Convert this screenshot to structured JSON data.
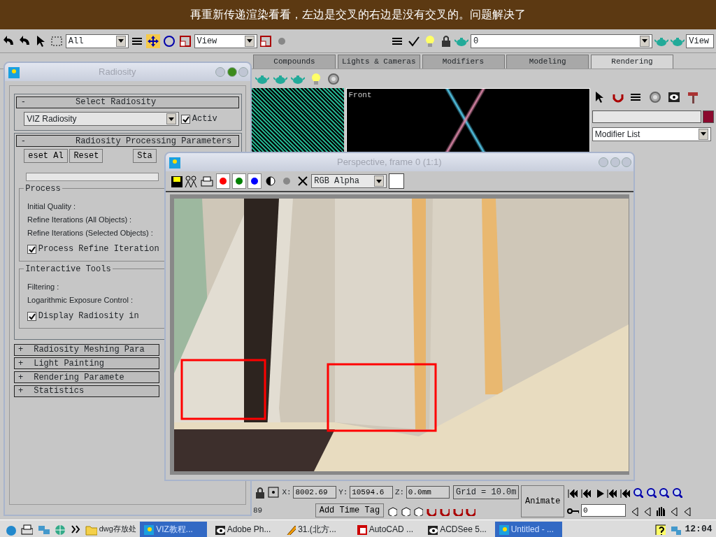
{
  "caption": "再重新传递渲染看看，左边是交叉的右边是没有交叉的。问题解决了",
  "toolbar": {
    "selection_filter": "All",
    "reference_system": "View",
    "layer": "0",
    "view_menu": "View"
  },
  "tabs": [
    {
      "label": "Compounds",
      "selected": false
    },
    {
      "label": "Lights & Cameras",
      "selected": false
    },
    {
      "label": "Modifiers",
      "selected": false
    },
    {
      "label": "Modeling",
      "selected": false
    },
    {
      "label": "Rendering",
      "selected": true
    }
  ],
  "viewport": {
    "label": "Front"
  },
  "command_panel": {
    "modifier_list": "Modifier List"
  },
  "radiosity_window": {
    "title": "Radiosity",
    "select": {
      "toggle": "-",
      "title": "Select Radiosity",
      "engine": "VIZ Radiosity",
      "active": {
        "label": "Activ",
        "checked": true
      }
    },
    "processing": {
      "toggle": "-",
      "title": "Radiosity Processing Parameters",
      "buttons": [
        "eset Al",
        "Reset",
        "Sta"
      ],
      "progress": {
        "level": 0
      },
      "groups": [
        {
          "title": "Process",
          "labels": [
            "Initial Quality :",
            "Refine Iterations (All Objects) :",
            "Refine Iterations (Selected Objects) :"
          ],
          "checkbox": {
            "label": "Process Refine Iteration",
            "checked": true
          }
        },
        {
          "title": "Interactive Tools",
          "labels": [
            "Filtering :",
            "Logarithmic Exposure Control :"
          ],
          "checkbox": {
            "label": "Display Radiosity in",
            "checked": true
          }
        }
      ]
    },
    "rollouts": [
      {
        "toggle": "+",
        "title": "Radiosity Meshing Para"
      },
      {
        "toggle": "+",
        "title": "Light Painting"
      },
      {
        "toggle": "+",
        "title": "Rendering Paramete"
      },
      {
        "toggle": "+",
        "title": "Statistics"
      }
    ]
  },
  "render_window": {
    "title": "Perspective, frame 0 (1:1)",
    "channels": [
      {
        "color": "#ff0000",
        "selected": true
      },
      {
        "color": "#008000",
        "selected": true
      },
      {
        "color": "#0000ff",
        "selected": true
      }
    ],
    "channel_display": "RGB Alpha"
  },
  "status": {
    "frame_info": "89",
    "coords": [
      {
        "label": "X:",
        "value": "8002.69"
      },
      {
        "label": "Y:",
        "value": "10594.6"
      },
      {
        "label": "Z:",
        "value": "0.0mm"
      }
    ],
    "grid": "Grid = 10.0m",
    "animate": "Animate",
    "time_tag": "Add Time Tag",
    "frame": "0"
  },
  "taskbar": {
    "folder": "dwg存放处",
    "items": [
      {
        "label": "VIZ教程...",
        "selected": true
      },
      {
        "label": "Adobe Ph...",
        "selected": false
      },
      {
        "label": "31.(北方...",
        "selected": false
      },
      {
        "label": "AutoCAD ...",
        "selected": false
      },
      {
        "label": "ACDSee 5...",
        "selected": false
      },
      {
        "label": "Untitled - ...",
        "selected": true
      }
    ],
    "clock": "12:04"
  }
}
